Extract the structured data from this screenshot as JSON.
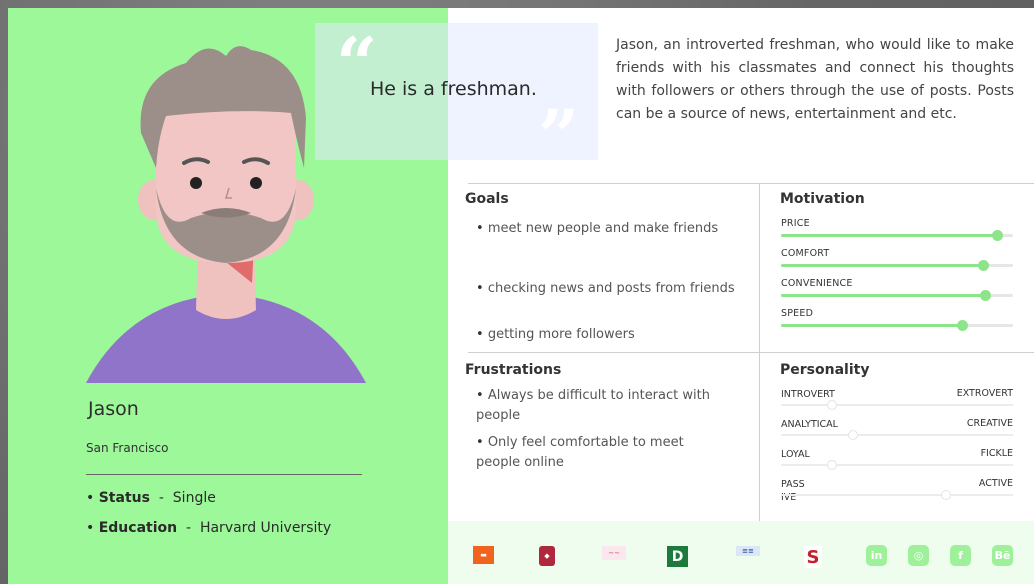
{
  "persona": {
    "name": "Jason",
    "location": "San Francisco",
    "status_label": "Status",
    "status_value": "Single",
    "education_label": "Education",
    "education_value": "Harvard University"
  },
  "quote": {
    "text": "He is a freshman."
  },
  "bio": "Jason, an introverted freshman, who would like to make friends with his classmates and connect his thoughts with followers or others through the use of posts. Posts can be a source of news, entertainment and etc.",
  "goals": {
    "title": "Goals",
    "items": [
      "meet new people and make friends",
      "checking news and posts from friends",
      "getting more followers"
    ]
  },
  "frustrations": {
    "title": "Frustrations",
    "items": [
      "Always be difficult to interact with people",
      "Only feel comfortable to meet people online"
    ]
  },
  "motivation": {
    "title": "Motivation",
    "items": [
      {
        "label": "PRICE",
        "value": 0.93
      },
      {
        "label": "COMFORT",
        "value": 0.87
      },
      {
        "label": "CONVENIENCE",
        "value": 0.88
      },
      {
        "label": "SPEED",
        "value": 0.78
      }
    ]
  },
  "personality": {
    "title": "Personality",
    "items": [
      {
        "left": "INTROVERT",
        "right": "EXTROVERT",
        "value": 0.22
      },
      {
        "left": "ANALYTICAL",
        "right": "CREATIVE",
        "value": 0.31
      },
      {
        "left": "LOYAL",
        "right": "FICKLE",
        "value": 0.22
      },
      {
        "left": "PASS\nIVE",
        "right": "ACTIVE",
        "value": 0.71
      }
    ]
  },
  "colors": {
    "panel_green": "#9df89a",
    "accent_green": "#8de58a",
    "shirt_purple": "#8f74c9"
  },
  "footer": {
    "logos": [
      "orange-logo",
      "red-shield-logo",
      "pink-script-logo",
      "green-d-logo",
      "blue-text-logo",
      "red-s-logo"
    ],
    "social": [
      {
        "icon": "linkedin-icon",
        "glyph": "in"
      },
      {
        "icon": "instagram-icon",
        "glyph": "◎"
      },
      {
        "icon": "facebook-icon",
        "glyph": "f"
      },
      {
        "icon": "behance-icon",
        "glyph": "Bē"
      }
    ]
  }
}
